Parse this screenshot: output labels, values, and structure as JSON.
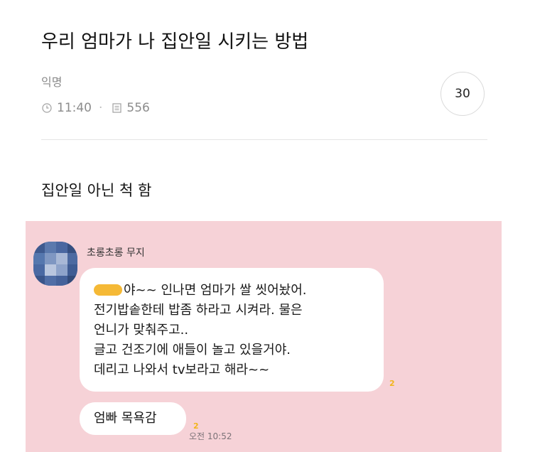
{
  "post": {
    "title": "우리 엄마가 나 집안일 시키는 방법",
    "author": "익명",
    "time": "11:40",
    "views": "556",
    "comment_count": "30",
    "body": "집안일 아닌 척 함"
  },
  "icons": {
    "clock": "clock-icon",
    "views": "document-icon"
  },
  "chat": {
    "background_color": "#f6d2d7",
    "sender": "초롱초롱 무지",
    "message_1": {
      "lines": [
        "야~~ 인나면 엄마가 쌀 씻어놨어.",
        "전기밥솥한테 밥좀 하라고 시켜라. 물은",
        "언니가 맞춰주고..",
        "글고 건조기에 애들이 놀고 있을거야.",
        "데리고 나와서 tv보라고 해라~~"
      ],
      "unread": "2"
    },
    "message_2": {
      "text": "엄빠 목욕감",
      "unread": "2",
      "time": "오전 10:52"
    }
  }
}
